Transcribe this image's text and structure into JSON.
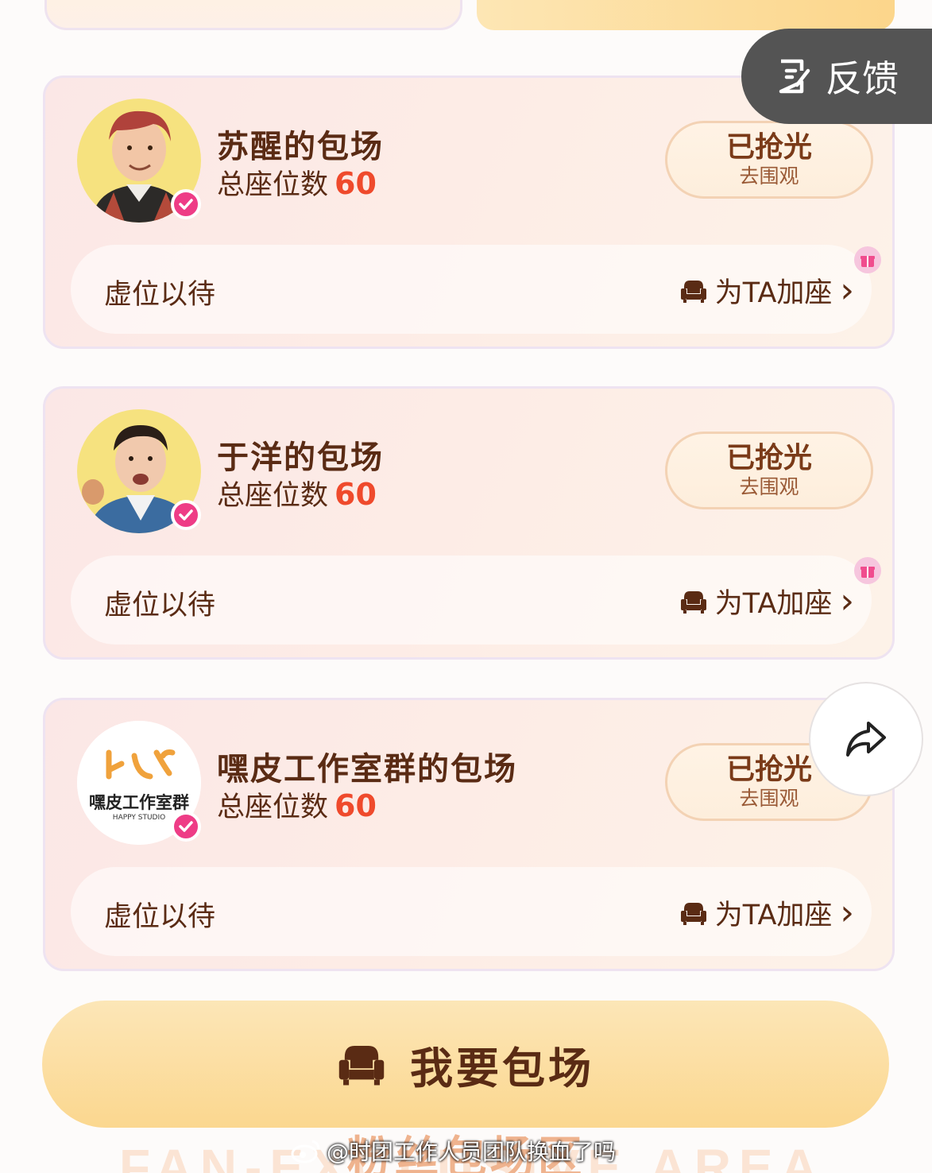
{
  "feedback": {
    "label": "反馈"
  },
  "cards": [
    {
      "title": "苏醒的包场",
      "seats_label": "总座位数",
      "seats_value": "60",
      "status": "已抢光",
      "status_sub": "去围观",
      "bar_left": "虚位以待",
      "bar_right": "为TA加座",
      "chevron": "›"
    },
    {
      "title": "于洋的包场",
      "seats_label": "总座位数",
      "seats_value": "60",
      "status": "已抢光",
      "status_sub": "去围观",
      "bar_left": "虚位以待",
      "bar_right": "为TA加座",
      "chevron": "›"
    },
    {
      "title": "嘿皮工作室群的包场",
      "seats_label": "总座位数",
      "seats_value": "60",
      "status": "已抢光",
      "status_sub": "去围观",
      "bar_left": "虚位以待",
      "bar_right": "为TA加座",
      "chevron": "›",
      "logo_name": "嘿皮工作室群",
      "logo_sub": "HAPPY STUDIO"
    }
  ],
  "cta": {
    "label": "我要包场"
  },
  "footer": {
    "heading": "粉丝包场区",
    "heading_en": "FAN-EXCLUSIVE AREA"
  },
  "watermark": {
    "text": "@时团工作人员团队换血了吗"
  },
  "icons": {
    "feedback": "feedback-doc-icon",
    "verified": "verified-check-icon",
    "sofa": "sofa-icon",
    "gift": "gift-icon",
    "share": "share-arrow-icon",
    "weibo": "weibo-logo-icon"
  },
  "colors": {
    "accent_number": "#ef4a2c",
    "text_brown": "#5a2b14",
    "verified": "#ee3c86",
    "cta_gold": "#fbd78f"
  }
}
